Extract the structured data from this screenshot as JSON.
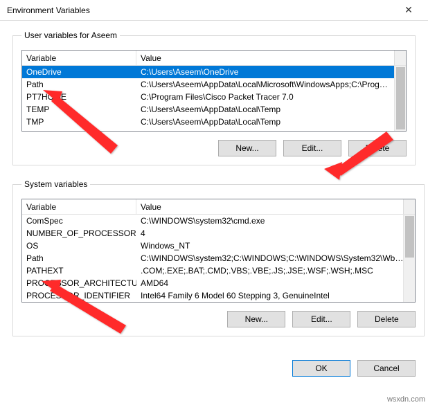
{
  "window": {
    "title": "Environment Variables",
    "close_glyph": "✕"
  },
  "user_section": {
    "legend": "User variables for Aseem",
    "headers": {
      "variable": "Variable",
      "value": "Value"
    },
    "rows": [
      {
        "name": "OneDrive",
        "value": "C:\\Users\\Aseem\\OneDrive",
        "selected": true
      },
      {
        "name": "Path",
        "value": "C:\\Users\\Aseem\\AppData\\Local\\Microsoft\\WindowsApps;C:\\Prog…"
      },
      {
        "name": "PT7HOME",
        "value": "C:\\Program Files\\Cisco Packet Tracer 7.0"
      },
      {
        "name": "TEMP",
        "value": "C:\\Users\\Aseem\\AppData\\Local\\Temp"
      },
      {
        "name": "TMP",
        "value": "C:\\Users\\Aseem\\AppData\\Local\\Temp"
      }
    ],
    "buttons": {
      "new": "New...",
      "edit": "Edit...",
      "delete": "Delete"
    }
  },
  "system_section": {
    "legend": "System variables",
    "headers": {
      "variable": "Variable",
      "value": "Value"
    },
    "rows": [
      {
        "name": "ComSpec",
        "value": "C:\\WINDOWS\\system32\\cmd.exe"
      },
      {
        "name": "NUMBER_OF_PROCESSORS",
        "value": "4"
      },
      {
        "name": "OS",
        "value": "Windows_NT"
      },
      {
        "name": "Path",
        "value": "C:\\WINDOWS\\system32;C:\\WINDOWS;C:\\WINDOWS\\System32\\Wb…"
      },
      {
        "name": "PATHEXT",
        "value": ".COM;.EXE;.BAT;.CMD;.VBS;.VBE;.JS;.JSE;.WSF;.WSH;.MSC"
      },
      {
        "name": "PROCESSOR_ARCHITECTURE",
        "value": "AMD64"
      },
      {
        "name": "PROCESSOR_IDENTIFIER",
        "value": "Intel64 Family 6 Model 60 Stepping 3, GenuineIntel"
      }
    ],
    "buttons": {
      "new": "New...",
      "edit": "Edit...",
      "delete": "Delete"
    }
  },
  "dialog_buttons": {
    "ok": "OK",
    "cancel": "Cancel"
  },
  "watermark": "wsxdn.com"
}
